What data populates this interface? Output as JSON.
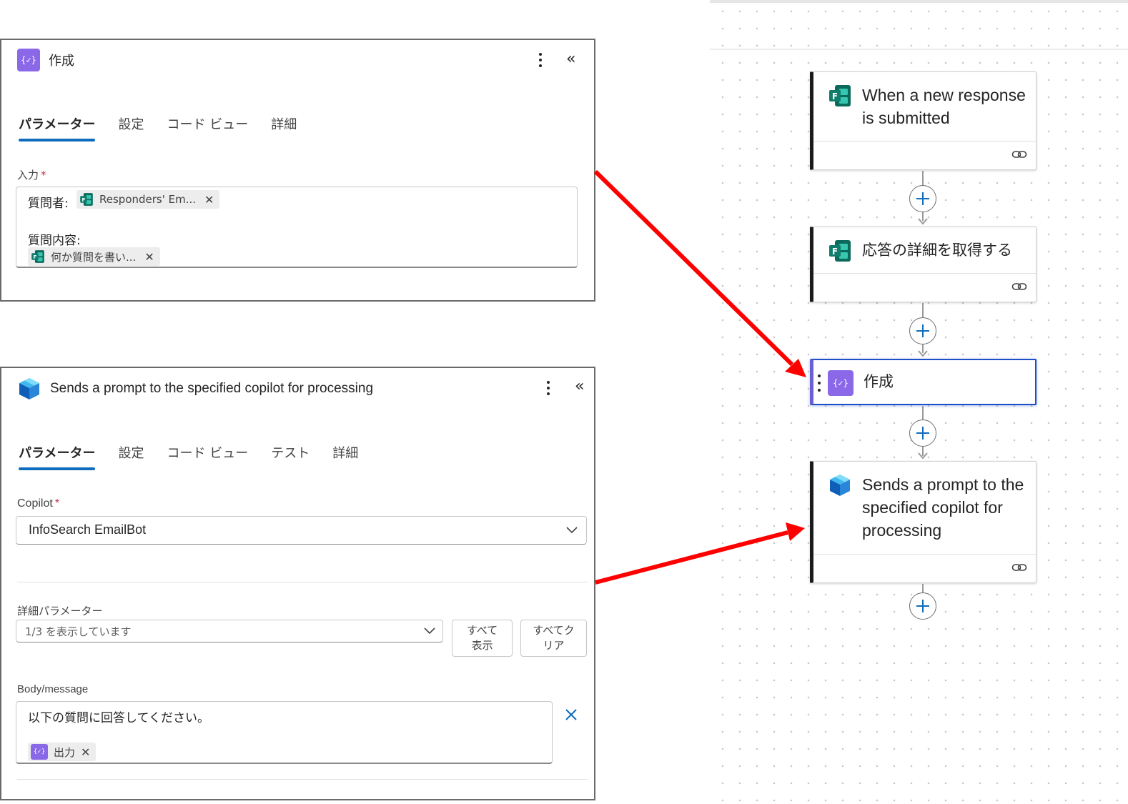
{
  "compose_panel": {
    "title": "作成",
    "tabs": [
      "パラメーター",
      "設定",
      "コード ビュー",
      "詳細"
    ],
    "input_label": "入力",
    "required_mark": "*",
    "questioner_label": "質問者:",
    "questioner_token": "Responders' Em...",
    "question_label": "質問内容:",
    "question_token": "何か質問を書い...",
    "token_remove": "✕"
  },
  "copilot_panel": {
    "title": "Sends a prompt to the specified copilot for processing",
    "tabs": [
      "パラメーター",
      "設定",
      "コード ビュー",
      "テスト",
      "詳細"
    ],
    "copilot_label": "Copilot",
    "required_mark": "*",
    "copilot_value": "InfoSearch EmailBot",
    "advanced_label": "詳細パラメーター",
    "advanced_value": "1/3 を表示しています",
    "show_all_button": "すべて\n表示",
    "clear_all_button": "すべてク\nリア",
    "body_label": "Body/message",
    "body_text": "以下の質問に回答してください。",
    "output_token": "出力",
    "token_remove": "✕"
  },
  "flow": {
    "nodes": [
      {
        "title": "When a new response is submitted",
        "icon": "forms-icon"
      },
      {
        "title": "応答の詳細を取得する",
        "icon": "forms-icon"
      },
      {
        "title": "作成",
        "icon": "compose-icon"
      },
      {
        "title": "Sends a prompt to the specified copilot for processing",
        "icon": "copilot-icon"
      }
    ]
  },
  "colors": {
    "accent_tab": "#0f6cbd",
    "compose_purple": "#8a68e8",
    "arrow_red": "#ff0000",
    "selected_border": "#1e4fc4"
  }
}
